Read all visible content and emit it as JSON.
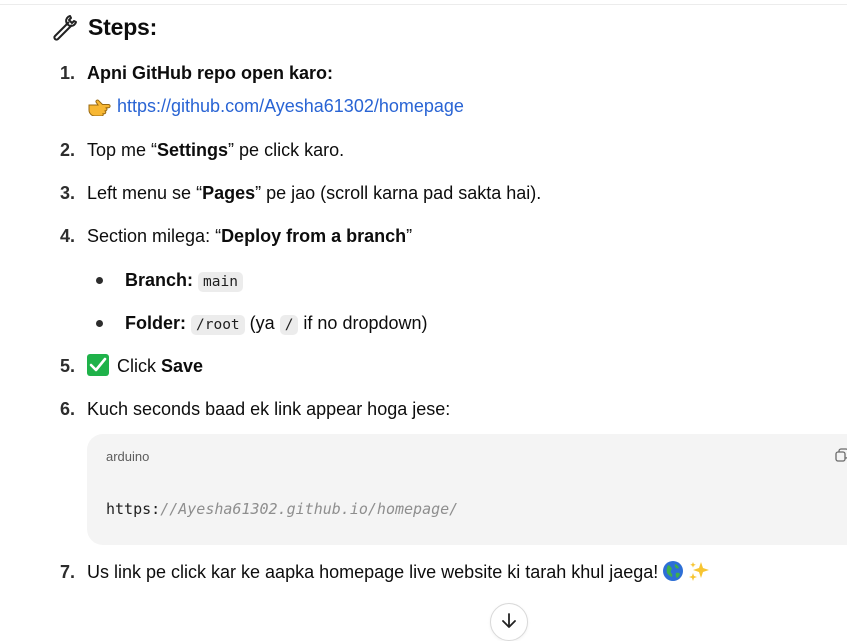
{
  "heading": {
    "icon": "wrench-icon",
    "title": "Steps:"
  },
  "steps": [
    {
      "num": "1.",
      "bold": "Apni GitHub repo open karo:"
    },
    {
      "num": "2.",
      "pre": "Top me “",
      "bold": "Settings",
      "post": "” pe click karo."
    },
    {
      "num": "3.",
      "pre": "Left menu se “",
      "bold": "Pages",
      "post": "” pe jao (scroll karna pad sakta hai)."
    },
    {
      "num": "4.",
      "pre": "Section milega: “",
      "bold": "Deploy from a branch",
      "post": "”"
    },
    {
      "num": "5.",
      "icon": "check-mark-icon",
      "pre": "Click ",
      "bold": "Save"
    },
    {
      "num": "6.",
      "pre": "Kuch seconds baad ek link appear hoga jese:"
    },
    {
      "num": "7.",
      "pre": "Us link pe click kar ke aapka homepage live website ki tarah khul jaega!"
    }
  ],
  "repo_link": {
    "icon": "pointing-hand-icon",
    "url": "https://github.com/Ayesha61302/homepage"
  },
  "bullets": [
    {
      "label": "Branch:",
      "code": "main"
    },
    {
      "label": "Folder:",
      "code": "/root",
      "mid": " (ya ",
      "code2": "/",
      "post": " if no dropdown)"
    }
  ],
  "code_block": {
    "language": "arduino",
    "prefix": "https:",
    "comment": "//Ayesha61302.github.io/homepage/"
  },
  "colors": {
    "link": "#2964d4",
    "check_green": "#1fb24a",
    "code_bg": "#f4f4f4"
  }
}
